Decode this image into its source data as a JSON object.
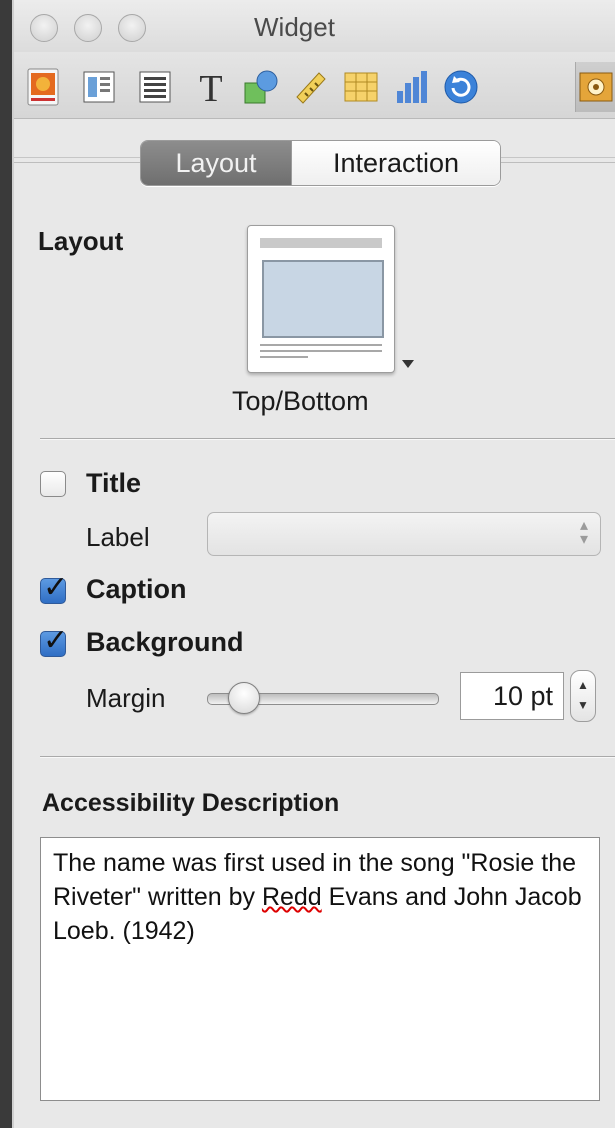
{
  "window": {
    "title": "Widget"
  },
  "toolbar": {
    "items": [
      {
        "icon": "document-icon"
      },
      {
        "icon": "layout-icon"
      },
      {
        "icon": "text-block-icon"
      },
      {
        "icon": "text-icon"
      },
      {
        "icon": "shapes-icon"
      },
      {
        "icon": "ruler-icon"
      },
      {
        "icon": "table-icon"
      },
      {
        "icon": "chart-icon"
      },
      {
        "icon": "refresh-icon"
      },
      {
        "icon": "widget-gear-icon",
        "selected": true
      }
    ]
  },
  "tabs": {
    "active": "Layout",
    "inactive": "Interaction"
  },
  "layout_section": {
    "heading": "Layout",
    "selected_layout": "Top/Bottom"
  },
  "options": {
    "title": {
      "label": "Title",
      "checked": false
    },
    "label_field": {
      "label": "Label",
      "value": ""
    },
    "caption": {
      "label": "Caption",
      "checked": true
    },
    "background": {
      "label": "Background",
      "checked": true
    },
    "margin": {
      "label": "Margin",
      "value": "10 pt",
      "slider_fraction": 0.12
    }
  },
  "accessibility": {
    "heading": "Accessibility Description",
    "text_before": "The name was first used in the song \"Rosie the Riveter\" written by ",
    "misspelled": "Redd",
    "text_after": " Evans and John Jacob Loeb. (1942)"
  },
  "colors": {
    "checkbox_checked": "#2f6ec4",
    "segment_active": "#7a7a7a"
  }
}
